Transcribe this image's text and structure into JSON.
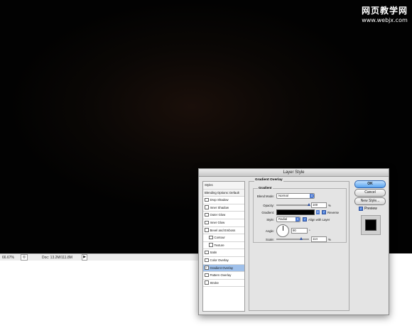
{
  "watermark": {
    "cn": "网页教学网",
    "url": "www.webjx.com"
  },
  "status_bar": {
    "zoom": "66.67%",
    "doc": "Doc: 13.2M/111.8M"
  },
  "dialog": {
    "title": "Layer Style",
    "styles_list": [
      {
        "label": "Styles",
        "kind": "header"
      },
      {
        "label": "Blending Options: Default",
        "kind": "header"
      },
      {
        "label": "Drop Shadow",
        "checked": false
      },
      {
        "label": "Inner Shadow",
        "checked": false
      },
      {
        "label": "Outer Glow",
        "checked": false
      },
      {
        "label": "Inner Glow",
        "checked": false
      },
      {
        "label": "Bevel and Emboss",
        "checked": false
      },
      {
        "label": "Contour",
        "checked": false,
        "sub": true
      },
      {
        "label": "Texture",
        "checked": false,
        "sub": true
      },
      {
        "label": "Satin",
        "checked": false
      },
      {
        "label": "Color Overlay",
        "checked": false
      },
      {
        "label": "Gradient Overlay",
        "checked": true,
        "selected": true
      },
      {
        "label": "Pattern Overlay",
        "checked": false
      },
      {
        "label": "Stroke",
        "checked": false
      }
    ],
    "panel": {
      "title": "Gradient Overlay",
      "group_title": "Gradient",
      "blend_mode_label": "Blend Mode:",
      "blend_mode_value": "Normal",
      "opacity_label": "Opacity:",
      "opacity_value": "100",
      "opacity_unit": "%",
      "opacity_fraction": 1.0,
      "gradient_label": "Gradient:",
      "reverse_label": "Reverse",
      "reverse_checked": true,
      "style_label": "Style:",
      "style_value": "Radial",
      "align_label": "Align with Layer",
      "align_checked": true,
      "angle_label": "Angle:",
      "angle_value": "90",
      "angle_unit": "°",
      "scale_label": "Scale:",
      "scale_value": "114",
      "scale_unit": "%",
      "scale_fraction": 0.76
    },
    "buttons": {
      "ok": "OK",
      "cancel": "Cancel",
      "new_style": "New Style..."
    },
    "preview": {
      "label": "Preview",
      "checked": true
    }
  }
}
